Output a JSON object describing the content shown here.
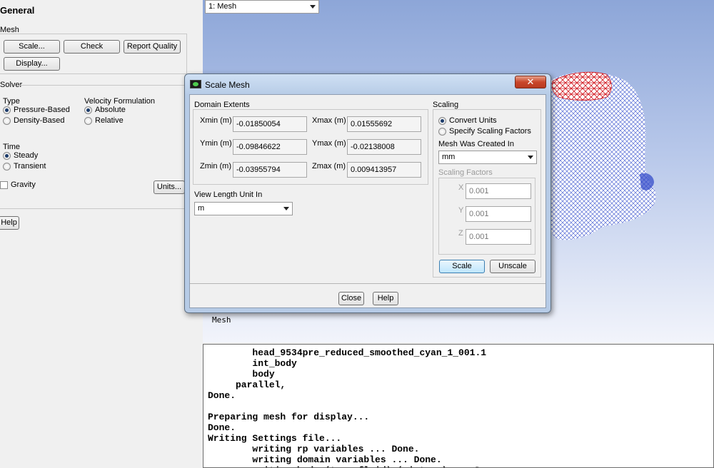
{
  "left_panel": {
    "title": "General",
    "mesh_label": "Mesh",
    "buttons": {
      "scale": "Scale...",
      "check": "Check",
      "report_quality": "Report Quality",
      "display": "Display..."
    },
    "solver_label": "Solver",
    "type_label": "Type",
    "type_options": [
      "Pressure-Based",
      "Density-Based"
    ],
    "velocity_label": "Velocity Formulation",
    "velocity_options": [
      "Absolute",
      "Relative"
    ],
    "time_label": "Time",
    "time_options": [
      "Steady",
      "Transient"
    ],
    "gravity_label": "Gravity",
    "units_button": "Units...",
    "help_button": "Help"
  },
  "viewport": {
    "view_select": "1: Mesh",
    "label": "Mesh"
  },
  "dialog": {
    "title": "Scale Mesh",
    "close_icon": "close-icon",
    "domain_extents_label": "Domain Extents",
    "xmin_label": "Xmin (m)",
    "xmin_value": "-0.01850054",
    "xmax_label": "Xmax (m)",
    "xmax_value": "0.01555692",
    "ymin_label": "Ymin (m)",
    "ymin_value": "-0.09846622",
    "ymax_label": "Ymax (m)",
    "ymax_value": "-0.02138008",
    "zmin_label": "Zmin (m)",
    "zmin_value": "-0.03955794",
    "zmax_label": "Zmax (m)",
    "zmax_value": "0.009413957",
    "view_length_label": "View Length Unit In",
    "view_length_value": "m",
    "scaling_label": "Scaling",
    "convert_units": "Convert Units",
    "specify_factors": "Specify Scaling Factors",
    "mesh_created_label": "Mesh Was Created In",
    "mesh_created_value": "mm",
    "scaling_factors_label": "Scaling Factors",
    "factor_x_label": "X",
    "factor_x_value": "0.001",
    "factor_y_label": "Y",
    "factor_y_value": "0.001",
    "factor_z_label": "Z",
    "factor_z_value": "0.001",
    "scale_button": "Scale",
    "unscale_button": "Unscale",
    "close_button": "Close",
    "help_button": "Help"
  },
  "console": {
    "lines": [
      "        head_9534pre_reduced_smoothed_cyan_1_001.1",
      "        int_body",
      "        body",
      "     parallel,",
      "Done.",
      "",
      "Preparing mesh for display...",
      "Done.",
      "Writing Settings file...",
      "        writing rp variables ... Done.",
      "        writing domain variables ... Done.",
      "        writing body (type fluid) (mixture) ... Done."
    ]
  },
  "colors": {
    "mesh_blue": "#2c44c8",
    "mesh_red": "#d0141c",
    "dialog_frame": "#b6cbe6",
    "close_red": "#c9462a"
  }
}
